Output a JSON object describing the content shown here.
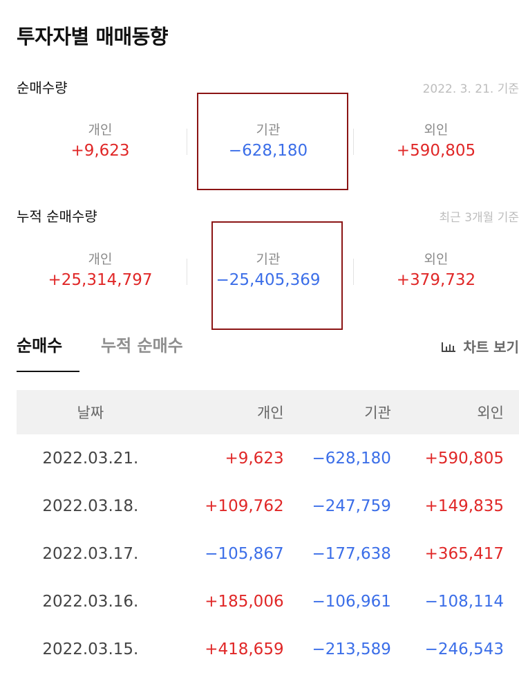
{
  "page_title": "투자자별 매매동향",
  "net_volume": {
    "label": "순매수량",
    "date": "2022. 3. 21. 기준",
    "stats": [
      {
        "label": "개인",
        "value": "+9,623"
      },
      {
        "label": "기관",
        "value": "−628,180"
      },
      {
        "label": "외인",
        "value": "+590,805"
      }
    ]
  },
  "cumulative": {
    "label": "누적 순매수량",
    "date": "최근 3개월 기준",
    "stats": [
      {
        "label": "개인",
        "value": "+25,314,797"
      },
      {
        "label": "기관",
        "value": "−25,405,369"
      },
      {
        "label": "외인",
        "value": "+379,732"
      }
    ]
  },
  "tabs": {
    "active": "순매수",
    "inactive": "누적 순매수",
    "chart_button": "차트 보기"
  },
  "table": {
    "headers": [
      "날짜",
      "개인",
      "기관",
      "외인"
    ],
    "rows": [
      [
        "2022.03.21.",
        "+9,623",
        "−628,180",
        "+590,805"
      ],
      [
        "2022.03.18.",
        "+109,762",
        "−247,759",
        "+149,835"
      ],
      [
        "2022.03.17.",
        "−105,867",
        "−177,638",
        "+365,417"
      ],
      [
        "2022.03.16.",
        "+185,006",
        "−106,961",
        "−108,114"
      ],
      [
        "2022.03.15.",
        "+418,659",
        "−213,589",
        "−246,543"
      ]
    ]
  },
  "colors": {
    "positive": "#e02727",
    "negative": "#3b6ee8",
    "highlight_box": "#8b1414"
  }
}
